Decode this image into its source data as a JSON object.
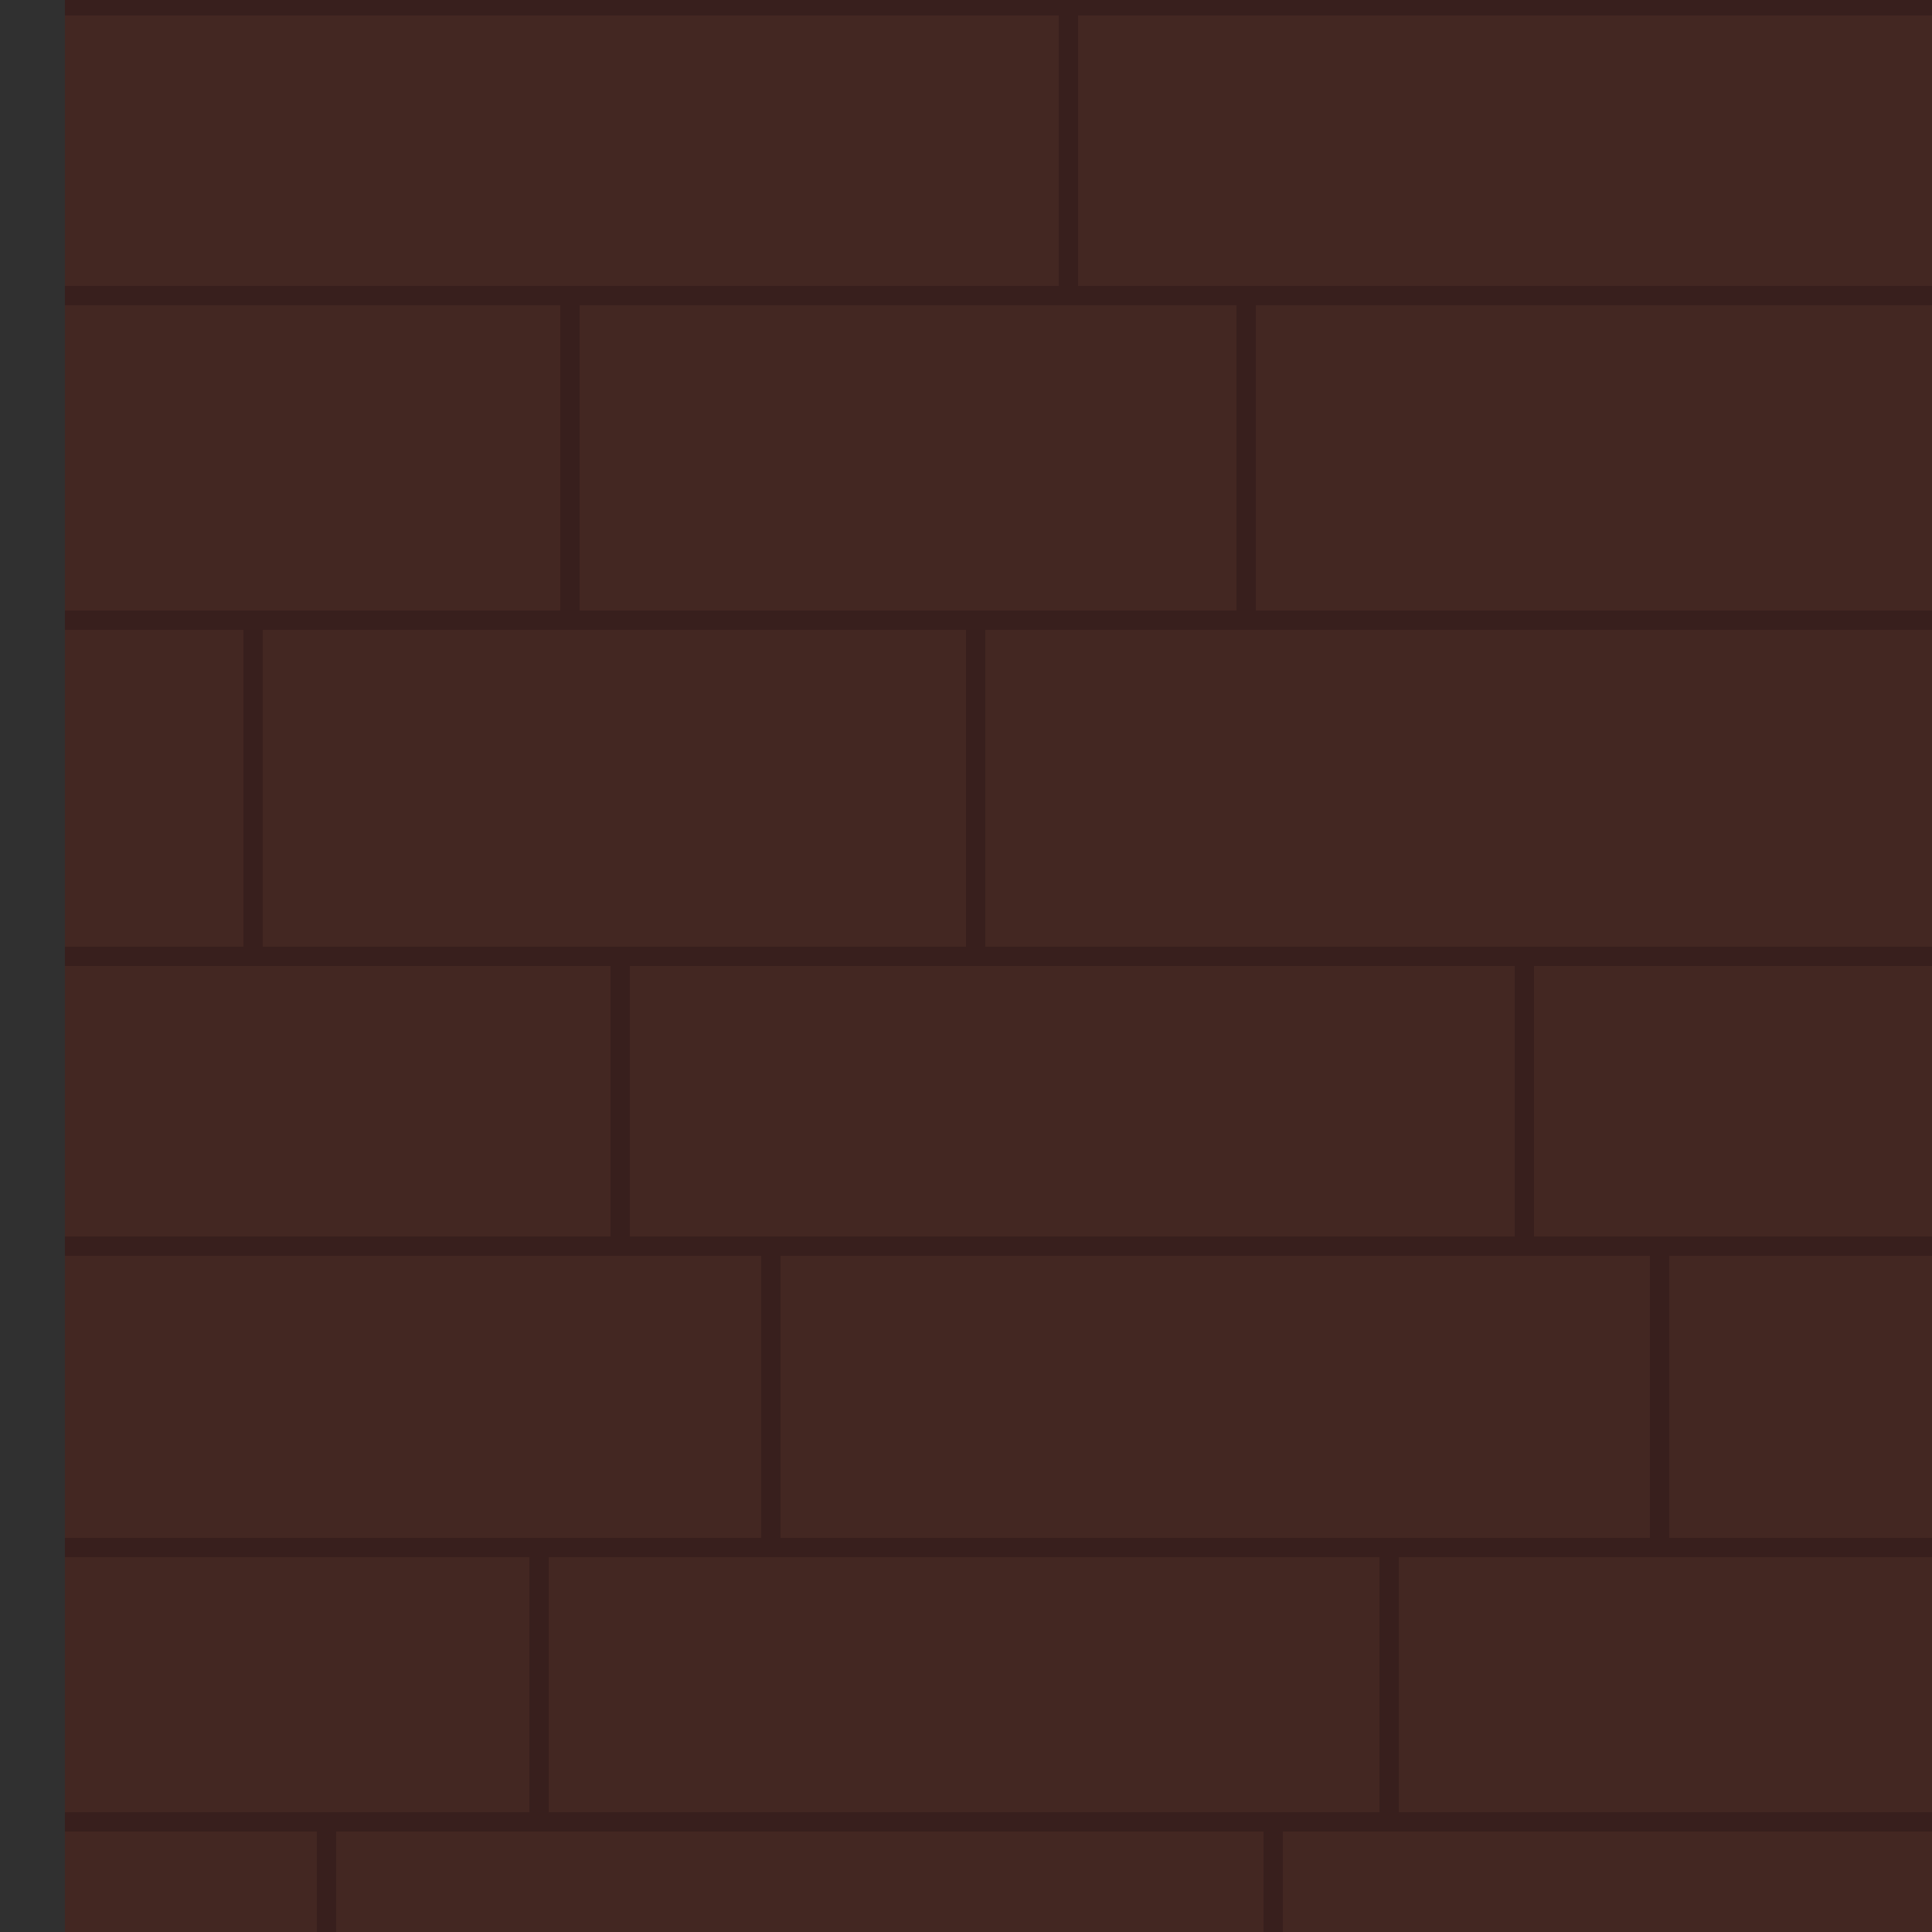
{
  "scene": {
    "description_tag": "",
    "colors": {
      "mortar": "#381f1d",
      "brick": "#432722",
      "left_edge": "#303030"
    },
    "icon_names": [
      "brick-tile"
    ],
    "brick_rows_visible": 7,
    "bricks_per_row": [
      2,
      3,
      3,
      3,
      3,
      3,
      3
    ]
  }
}
